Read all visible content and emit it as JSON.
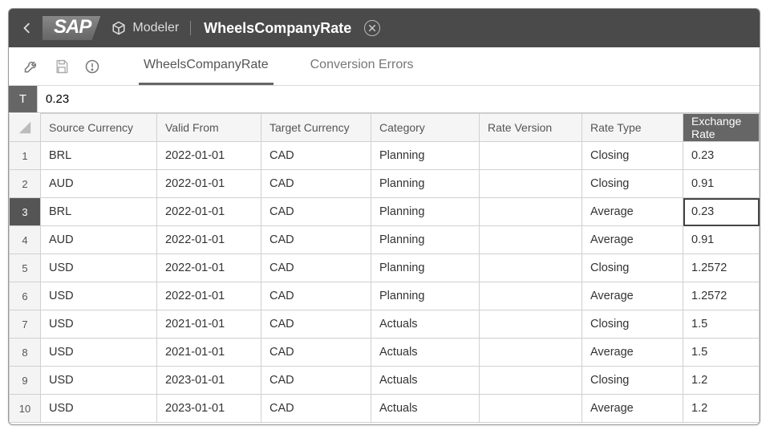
{
  "header": {
    "modeler_label": "Modeler",
    "title": "WheelsCompanyRate"
  },
  "tabs": {
    "main": "WheelsCompanyRate",
    "errors": "Conversion Errors"
  },
  "formula": {
    "type_label": "T",
    "value": "0.23"
  },
  "columns": {
    "source": "Source Currency",
    "valid_from": "Valid From",
    "target": "Target Currency",
    "category": "Category",
    "rate_version": "Rate Version",
    "rate_type": "Rate Type",
    "exchange_rate": "Exchange Rate"
  },
  "rows": [
    {
      "n": "1",
      "src": "BRL",
      "vf": "2022-01-01",
      "tgt": "CAD",
      "cat": "Planning",
      "rv": "",
      "rt": "Closing",
      "ex": "0.23"
    },
    {
      "n": "2",
      "src": "AUD",
      "vf": "2022-01-01",
      "tgt": "CAD",
      "cat": "Planning",
      "rv": "",
      "rt": "Closing",
      "ex": "0.91"
    },
    {
      "n": "3",
      "src": "BRL",
      "vf": "2022-01-01",
      "tgt": "CAD",
      "cat": "Planning",
      "rv": "",
      "rt": "Average",
      "ex": "0.23"
    },
    {
      "n": "4",
      "src": "AUD",
      "vf": "2022-01-01",
      "tgt": "CAD",
      "cat": "Planning",
      "rv": "",
      "rt": "Average",
      "ex": "0.91"
    },
    {
      "n": "5",
      "src": "USD",
      "vf": "2022-01-01",
      "tgt": "CAD",
      "cat": "Planning",
      "rv": "",
      "rt": "Closing",
      "ex": "1.2572"
    },
    {
      "n": "6",
      "src": "USD",
      "vf": "2022-01-01",
      "tgt": "CAD",
      "cat": "Planning",
      "rv": "",
      "rt": "Average",
      "ex": "1.2572"
    },
    {
      "n": "7",
      "src": "USD",
      "vf": "2021-01-01",
      "tgt": "CAD",
      "cat": "Actuals",
      "rv": "",
      "rt": "Closing",
      "ex": "1.5"
    },
    {
      "n": "8",
      "src": "USD",
      "vf": "2021-01-01",
      "tgt": "CAD",
      "cat": "Actuals",
      "rv": "",
      "rt": "Average",
      "ex": "1.5"
    },
    {
      "n": "9",
      "src": "USD",
      "vf": "2023-01-01",
      "tgt": "CAD",
      "cat": "Actuals",
      "rv": "",
      "rt": "Closing",
      "ex": "1.2"
    },
    {
      "n": "10",
      "src": "USD",
      "vf": "2023-01-01",
      "tgt": "CAD",
      "cat": "Actuals",
      "rv": "",
      "rt": "Average",
      "ex": "1.2"
    }
  ],
  "selected_row_index": 2,
  "editing_column": "ex"
}
